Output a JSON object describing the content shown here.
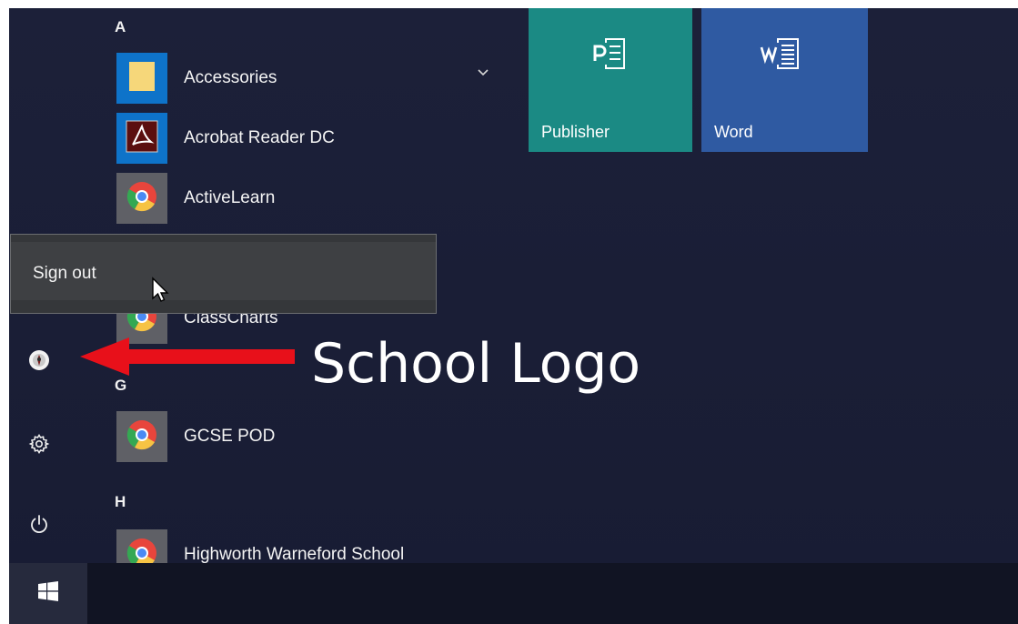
{
  "start_menu": {
    "sections": [
      {
        "letter": "A"
      },
      {
        "letter": "G"
      },
      {
        "letter": "H"
      }
    ],
    "apps": [
      {
        "label": "Accessories",
        "icon": "folder-icon",
        "tile_color": "#0e73c9"
      },
      {
        "label": "Acrobat Reader DC",
        "icon": "acrobat-icon",
        "tile_color": "#0e73c9"
      },
      {
        "label": "ActiveLearn",
        "icon": "chrome-icon",
        "tile_color": "#5f6066"
      },
      {
        "label": "ClassCharts",
        "icon": "chrome-icon",
        "tile_color": "#5f6066"
      },
      {
        "label": "GCSE POD",
        "icon": "chrome-icon",
        "tile_color": "#5f6066"
      },
      {
        "label": "Highworth Warneford School",
        "icon": "chrome-icon",
        "tile_color": "#5f6066"
      }
    ],
    "tiles": [
      {
        "label": "Publisher",
        "icon": "publisher-icon",
        "color": "#1b8a84"
      },
      {
        "label": "Word",
        "icon": "word-icon",
        "color": "#2f5aa2"
      }
    ],
    "rail": [
      {
        "name": "school-logo-icon"
      },
      {
        "name": "settings-icon"
      },
      {
        "name": "power-icon"
      }
    ],
    "popup": {
      "signout_label": "Sign out"
    }
  },
  "annotation": {
    "text": "School Logo",
    "arrow_color": "#e8101a"
  },
  "taskbar": {
    "start_icon": "windows-logo-icon"
  }
}
